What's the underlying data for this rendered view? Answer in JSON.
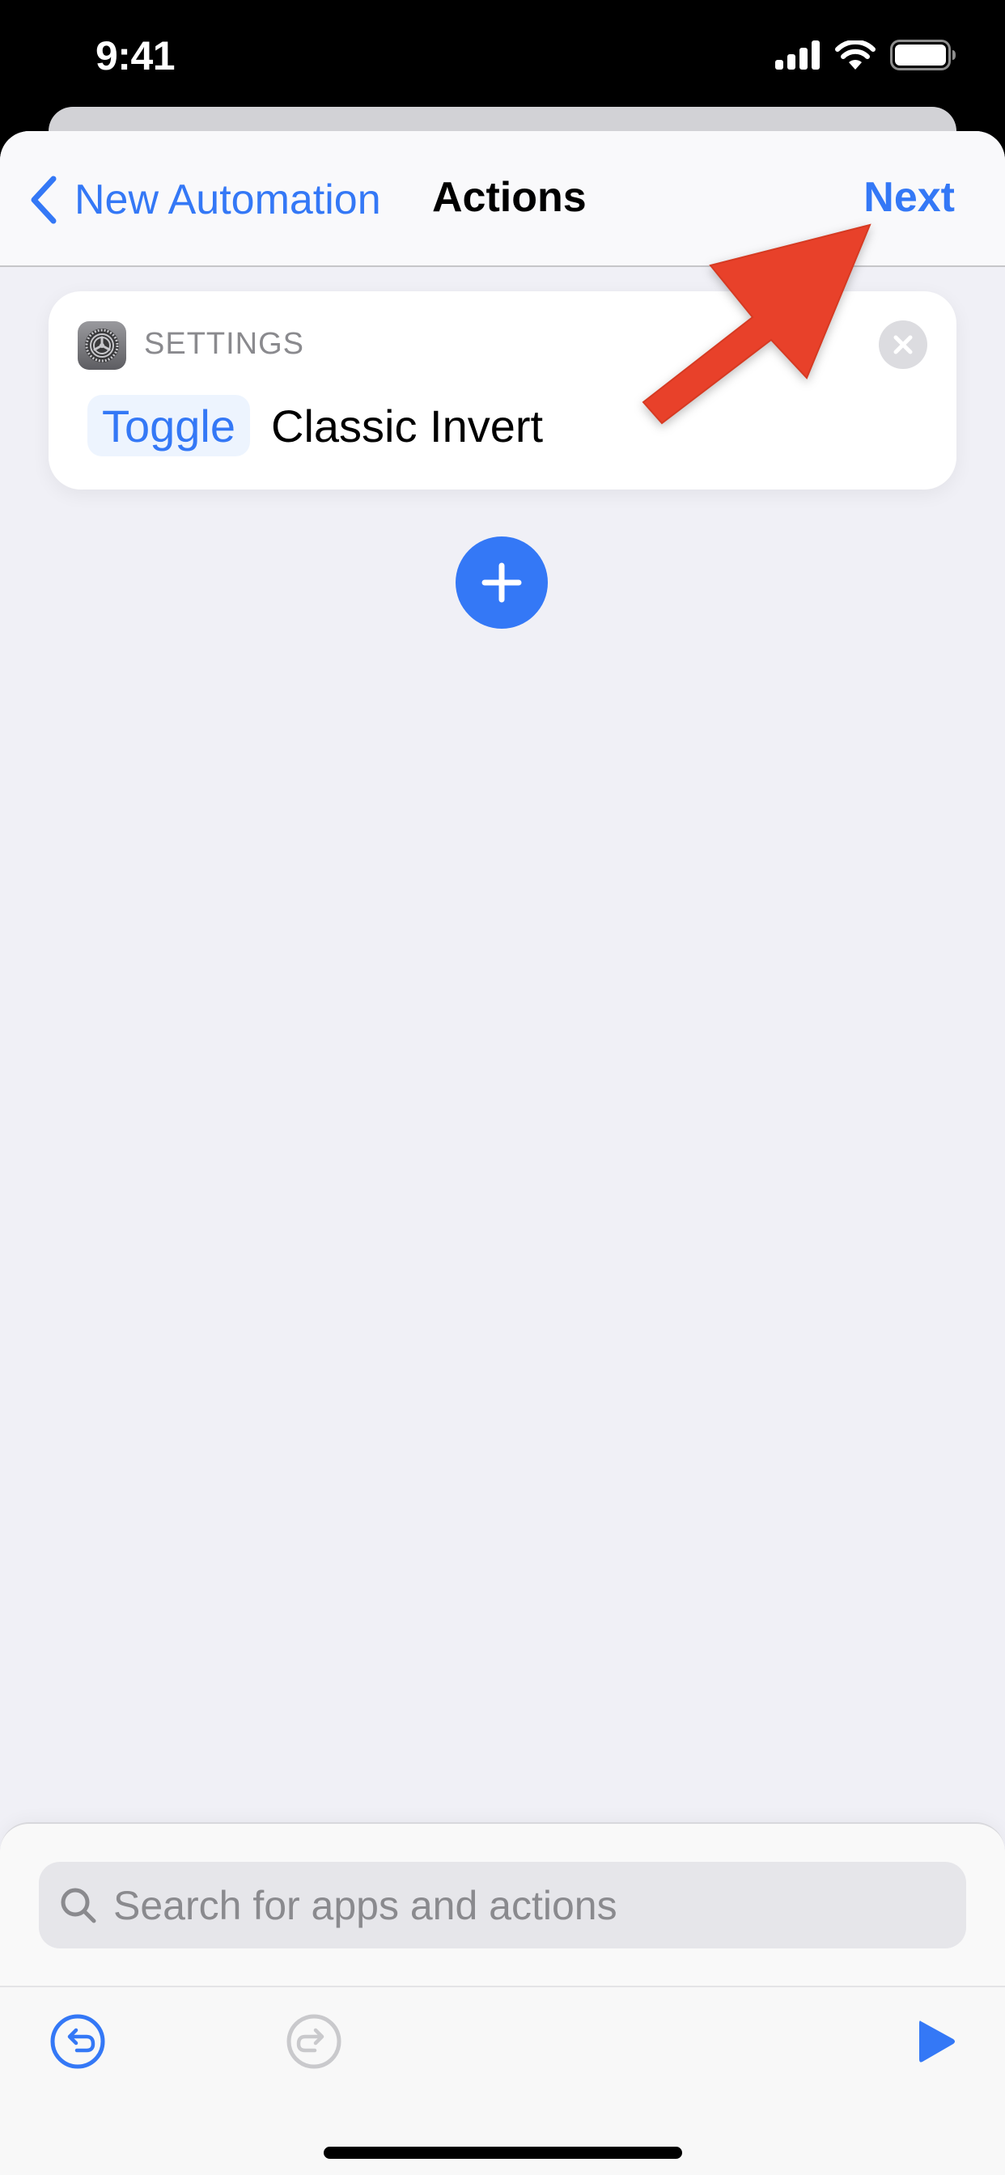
{
  "status_bar": {
    "time": "9:41",
    "icons": [
      "cellular-signal-icon",
      "wifi-icon",
      "battery-icon"
    ]
  },
  "nav": {
    "back_label": "New Automation",
    "back_icon": "chevron-left-icon",
    "title": "Actions",
    "next_label": "Next"
  },
  "action_card": {
    "app_icon": "settings-gear-icon",
    "app_name": "SETTINGS",
    "parameter": "Toggle",
    "action_text": "Classic Invert",
    "close_icon": "close-icon"
  },
  "add_button": {
    "icon": "plus-icon"
  },
  "search": {
    "placeholder": "Search for apps and actions",
    "value": "",
    "icon": "search-icon"
  },
  "toolbar": {
    "undo_icon": "undo-icon",
    "undo_enabled": true,
    "redo_icon": "redo-icon",
    "redo_enabled": false,
    "play_icon": "play-icon"
  },
  "annotation": {
    "type": "arrow",
    "points_to": "Next",
    "color": "#e8412a"
  },
  "colors": {
    "accent": "#3478f6",
    "background": "#f0f0f6",
    "card": "#ffffff",
    "secondary_text": "#8a8a8e"
  }
}
